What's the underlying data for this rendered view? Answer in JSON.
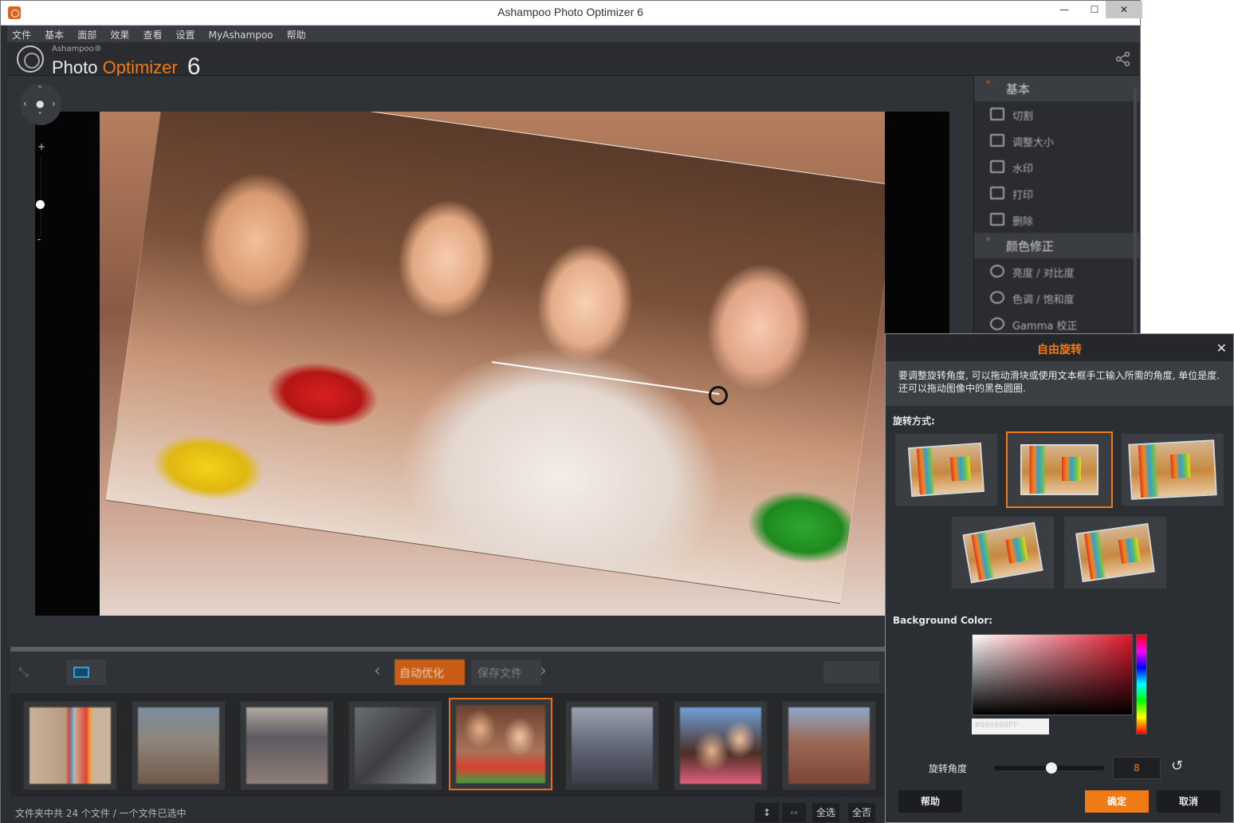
{
  "window": {
    "title": "Ashampoo Photo Optimizer 6",
    "controls": {
      "minimize": "—",
      "maximize": "☐",
      "close": "✕"
    }
  },
  "menu": [
    "文件",
    "基本",
    "面部",
    "效果",
    "查看",
    "设置",
    "MyAshampoo",
    "帮助"
  ],
  "logo": {
    "brand": "Ashampoo®",
    "photo": "Photo",
    "optimizer": "Optimizer",
    "version": "6"
  },
  "right_panel": {
    "sections": [
      {
        "label": "基本",
        "items": [
          "切割",
          "调整大小",
          "水印",
          "打印",
          "删除"
        ]
      },
      {
        "label": "颜色修正",
        "items": [
          "亮度 / 对比度",
          "色调 / 饱和度",
          "Gamma 校正"
        ]
      }
    ]
  },
  "toolbar": {
    "auto_optimize": "自动优化",
    "save_file": "保存文件"
  },
  "thumbnails": [
    {
      "desc": "beach-chairs"
    },
    {
      "desc": "cathedral"
    },
    {
      "desc": "bridge"
    },
    {
      "desc": "machinery"
    },
    {
      "desc": "family",
      "selected": true
    },
    {
      "desc": "pier"
    },
    {
      "desc": "friends"
    },
    {
      "desc": "ruins"
    }
  ],
  "status": {
    "text": "文件夹中共 24 个文件 / 一个文件已选中",
    "select_all": "全选",
    "select_none": "全否"
  },
  "dialog": {
    "title": "自由旋转",
    "intro": "要调整旋转角度, 可以拖动滑块或使用文本框手工输入所需的角度, 单位是度. 还可以拖动图像中的黑色圆圈.",
    "mode_label": "旋转方式:",
    "active_mode": 2,
    "bg_label": "Background Color:",
    "hex_value": "#000000FF",
    "angle_label": "旋转角度",
    "angle_value": "8",
    "angle_slider_fraction": 0.52,
    "buttons": {
      "help": "帮助",
      "ok": "确定",
      "cancel": "取消"
    }
  },
  "colors": {
    "accent": "#f07a14",
    "panel": "#2b2e33"
  }
}
